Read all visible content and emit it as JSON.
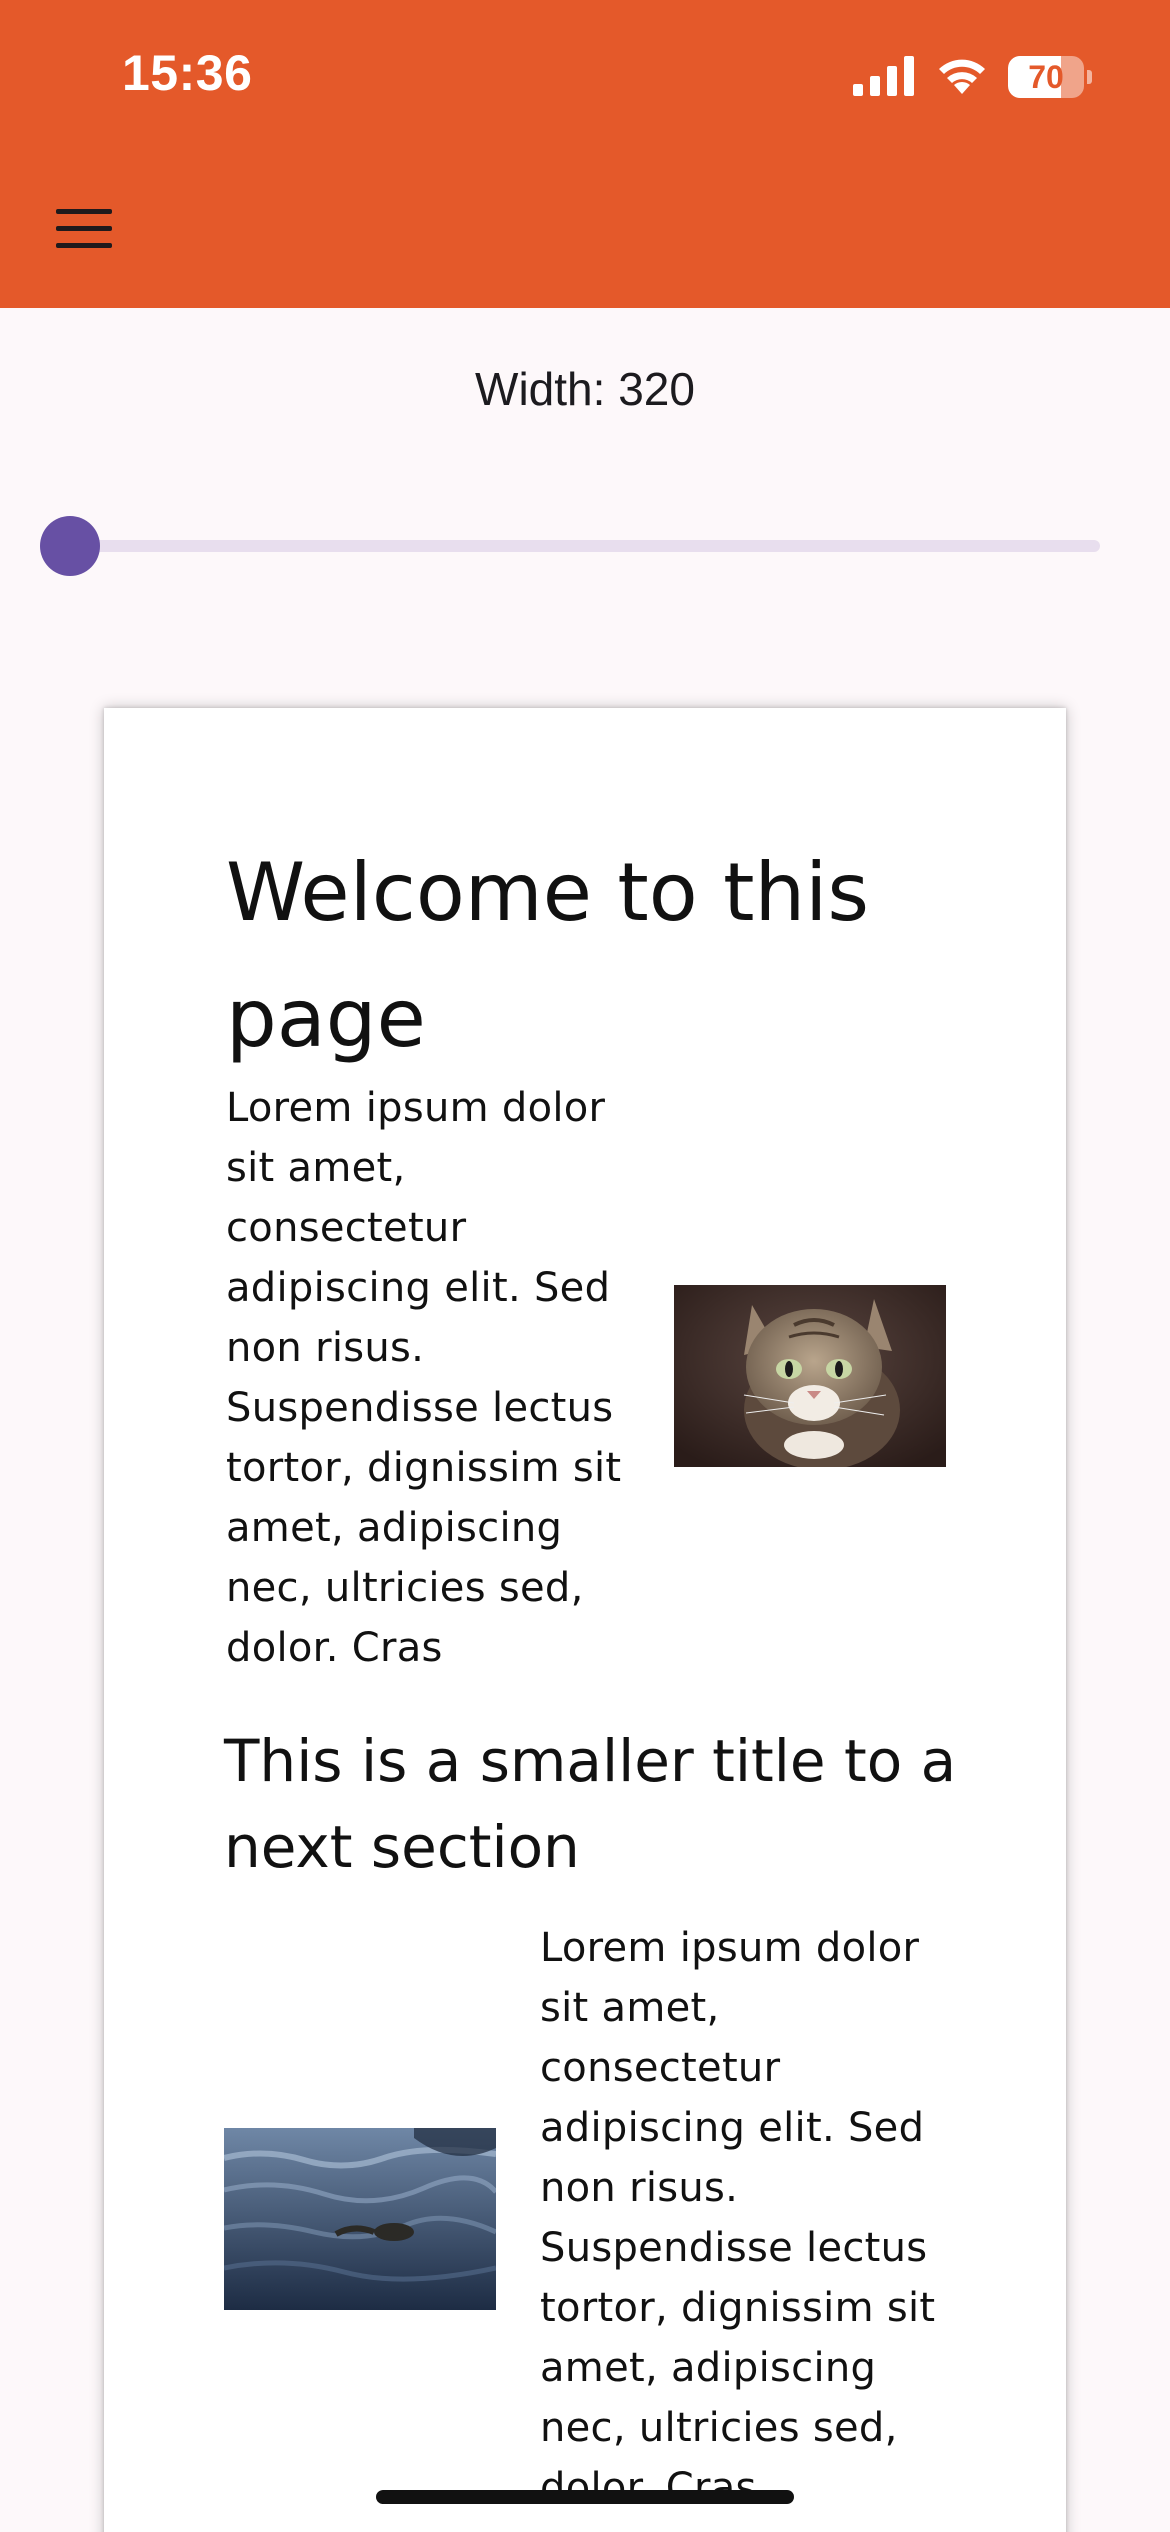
{
  "status_bar": {
    "time": "15:36",
    "battery_level": "70",
    "battery_fraction": 0.7
  },
  "app_bar": {
    "menu_icon": "hamburger-menu-icon",
    "background_color": "#e4592a"
  },
  "controls": {
    "width_label": "Width: 320",
    "slider_fraction": 0.0,
    "slider_color": "#6750a4"
  },
  "preview": {
    "heading": "Welcome to this page",
    "paragraph1": "Lorem ipsum dolor sit amet, consectetur adipiscing elit. Sed non risus. Suspendisse lectus tortor, dignissim sit amet, adipiscing nec, ultricies sed, dolor. Cras",
    "subheading": "This is a smaller title to a next section",
    "paragraph2": "Lorem ipsum dolor sit amet, consectetur adipiscing elit. Sed non risus. Suspendisse lectus tortor, dignissim sit amet, adipiscing nec, ultricies sed, dolor. Cras",
    "image1": "cat-photo",
    "image2": "water-photo"
  }
}
